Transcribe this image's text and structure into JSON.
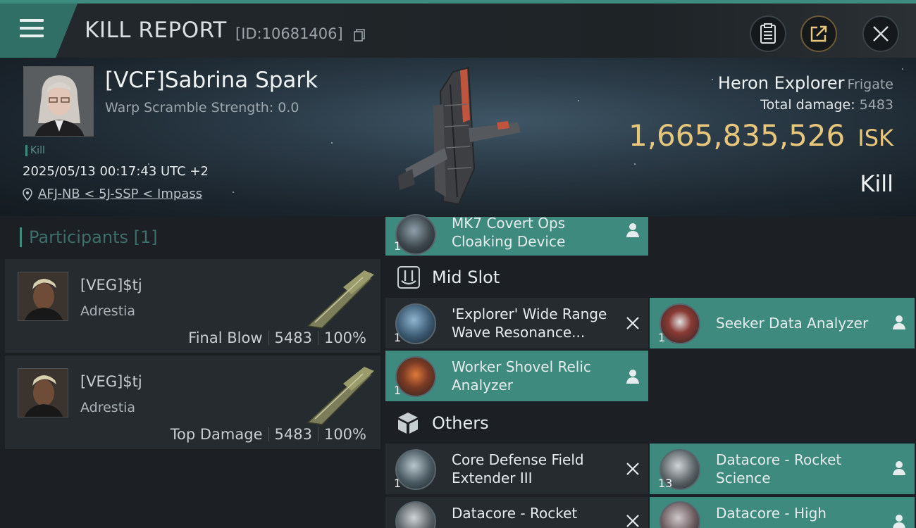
{
  "header": {
    "title": "KILL REPORT",
    "report_id": "[ID:10681406]"
  },
  "victim": {
    "name": "[VCF]Sabrina Spark",
    "warp_scramble": "Warp Scramble Strength: 0.0",
    "tag": "Kill",
    "datetime": "2025/05/13 00:17:43 UTC +2",
    "location": "AFJ-NB < 5J-SSP < Impass"
  },
  "ship": {
    "name": "Heron Explorer",
    "class": "Frigate",
    "total_damage_label": "Total damage:",
    "total_damage": "5483",
    "isk_value": "1,665,835,526",
    "isk_unit": "ISK",
    "result": "Kill"
  },
  "participants": {
    "label": "Participants",
    "count": "[1]",
    "items": [
      {
        "name": "[VEG]$tj",
        "ship": "Adrestia",
        "role": "Final Blow",
        "damage": "5483",
        "percent": "100%"
      },
      {
        "name": "[VEG]$tj",
        "ship": "Adrestia",
        "role": "Top Damage",
        "damage": "5483",
        "percent": "100%"
      }
    ]
  },
  "fitting": {
    "top_item": {
      "name_line1": "MK7 Covert Ops",
      "name_line2": "Cloaking Device",
      "qty": "1"
    },
    "mid_slot": {
      "label": "Mid Slot",
      "items": [
        {
          "name_line1": "'Explorer' Wide Range",
          "name_line2": "Wave Resonance...",
          "qty": "1",
          "status": "destroyed"
        },
        {
          "name_line1": "Seeker Data Analyzer",
          "name_line2": "",
          "qty": "1",
          "status": "dropped"
        },
        {
          "name_line1": "Worker Shovel Relic",
          "name_line2": "Analyzer",
          "qty": "1",
          "status": "dropped"
        }
      ]
    },
    "others": {
      "label": "Others",
      "items": [
        {
          "name_line1": "Core Defense Field",
          "name_line2": "Extender III",
          "qty": "1",
          "status": "destroyed"
        },
        {
          "name_line1": "Datacore - Rocket",
          "name_line2": "Science",
          "qty": "13",
          "status": "dropped"
        },
        {
          "name_line1": "Datacore - Rocket",
          "name_line2": "",
          "qty": "",
          "status": "destroyed"
        },
        {
          "name_line1": "Datacore - High",
          "name_line2": "",
          "qty": "",
          "status": "dropped"
        }
      ]
    }
  },
  "colors": {
    "accent": "#3e8c80",
    "isk": "#e8c77c",
    "panel": "#262b2f",
    "dropped": "#3f8a7f"
  },
  "icons": [
    "menu-icon",
    "copy-icon",
    "clipboard-icon",
    "share-icon",
    "close-icon",
    "location-pin-icon",
    "person-icon",
    "cross-icon",
    "mid-slot-icon",
    "cube-icon"
  ]
}
